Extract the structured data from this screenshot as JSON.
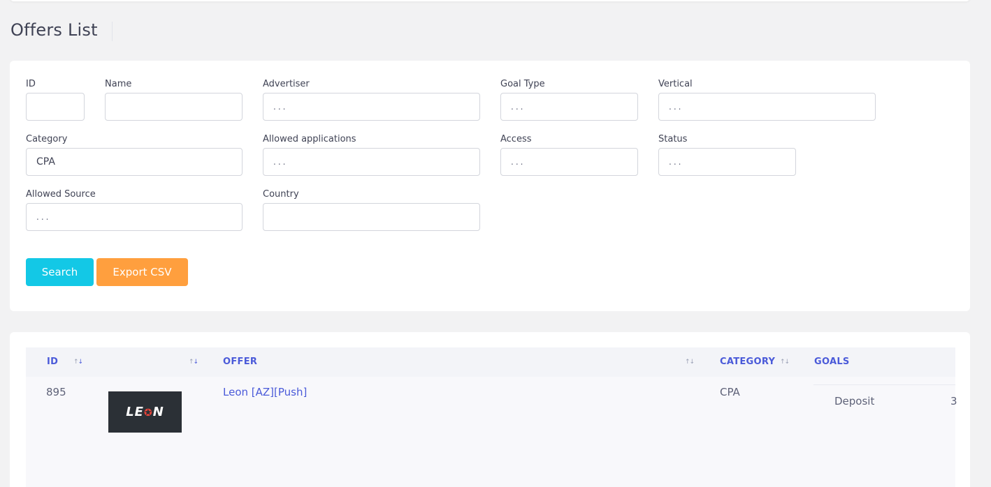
{
  "page": {
    "title": "Offers List"
  },
  "filters": {
    "id": {
      "label": "ID",
      "value": ""
    },
    "name": {
      "label": "Name",
      "value": ""
    },
    "advertiser": {
      "label": "Advertiser",
      "value": "..."
    },
    "goal_type": {
      "label": "Goal Type",
      "value": "..."
    },
    "vertical": {
      "label": "Vertical",
      "value": "..."
    },
    "category": {
      "label": "Category",
      "value": "CPA"
    },
    "allowed_applications": {
      "label": "Allowed applications",
      "value": "..."
    },
    "access": {
      "label": "Access",
      "value": "..."
    },
    "status": {
      "label": "Status",
      "value": "..."
    },
    "allowed_source": {
      "label": "Allowed Source",
      "value": "..."
    },
    "country": {
      "label": "Country",
      "value": ""
    }
  },
  "buttons": {
    "search": "Search",
    "export": "Export CSV"
  },
  "colors": {
    "search_button": "#13c8e6",
    "export_button": "#ff9f3e",
    "link": "#4a5ad9"
  },
  "table": {
    "columns": {
      "id": "ID",
      "offer": "OFFER",
      "category": "CATEGORY",
      "goals": "GOALS"
    },
    "rows": [
      {
        "id": "895",
        "logo_text": "LE",
        "logo_text_2": "N",
        "offer": "Leon [AZ][Push]",
        "category": "CPA",
        "goal": "Deposit",
        "goal_value": "3"
      }
    ]
  },
  "icons": {
    "sort": "sort-arrows-icon",
    "logo_star": "star-icon"
  }
}
